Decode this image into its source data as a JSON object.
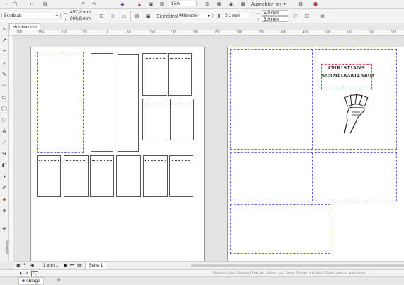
{
  "toolbar": {
    "zoom": "35%",
    "snap_label": "Ausrichten an",
    "snap_arrow": "▼"
  },
  "propbar": {
    "page_preset": "Breitblatt",
    "width": "457,2 mm",
    "height": "609,6 mm",
    "units_label": "Einheiten:",
    "units_value": "Millimeter",
    "nudge": "0,1 mm",
    "dup_x": "5,0 mm",
    "dup_y": "5,0 mm"
  },
  "document": {
    "tab_name": "Holzbox.cdr"
  },
  "ruler": {
    "h_ticks": [
      "200",
      "150",
      "100",
      "50",
      "0",
      "50",
      "100",
      "150",
      "200",
      "250",
      "300",
      "350",
      "400",
      "450",
      "500",
      "550",
      "600",
      "650"
    ],
    "v_label": "Millimeter"
  },
  "card": {
    "line1": "CHRISTIANS",
    "line2": "SAMMELKARTENBOX"
  },
  "pager": {
    "page_count": "1 von 1",
    "page_tab": "Seite 1"
  },
  "palette": {
    "hint": "Farben (oder Objekte) hierher ziehen, um diese Farben mit dem Dokument zu speichern"
  },
  "status": {
    "docker_tab": "Ablage"
  },
  "colors": {
    "deco_border": "#6a6adf",
    "title_border": "#e05050",
    "canvas_bg": "#e3e3e3"
  }
}
